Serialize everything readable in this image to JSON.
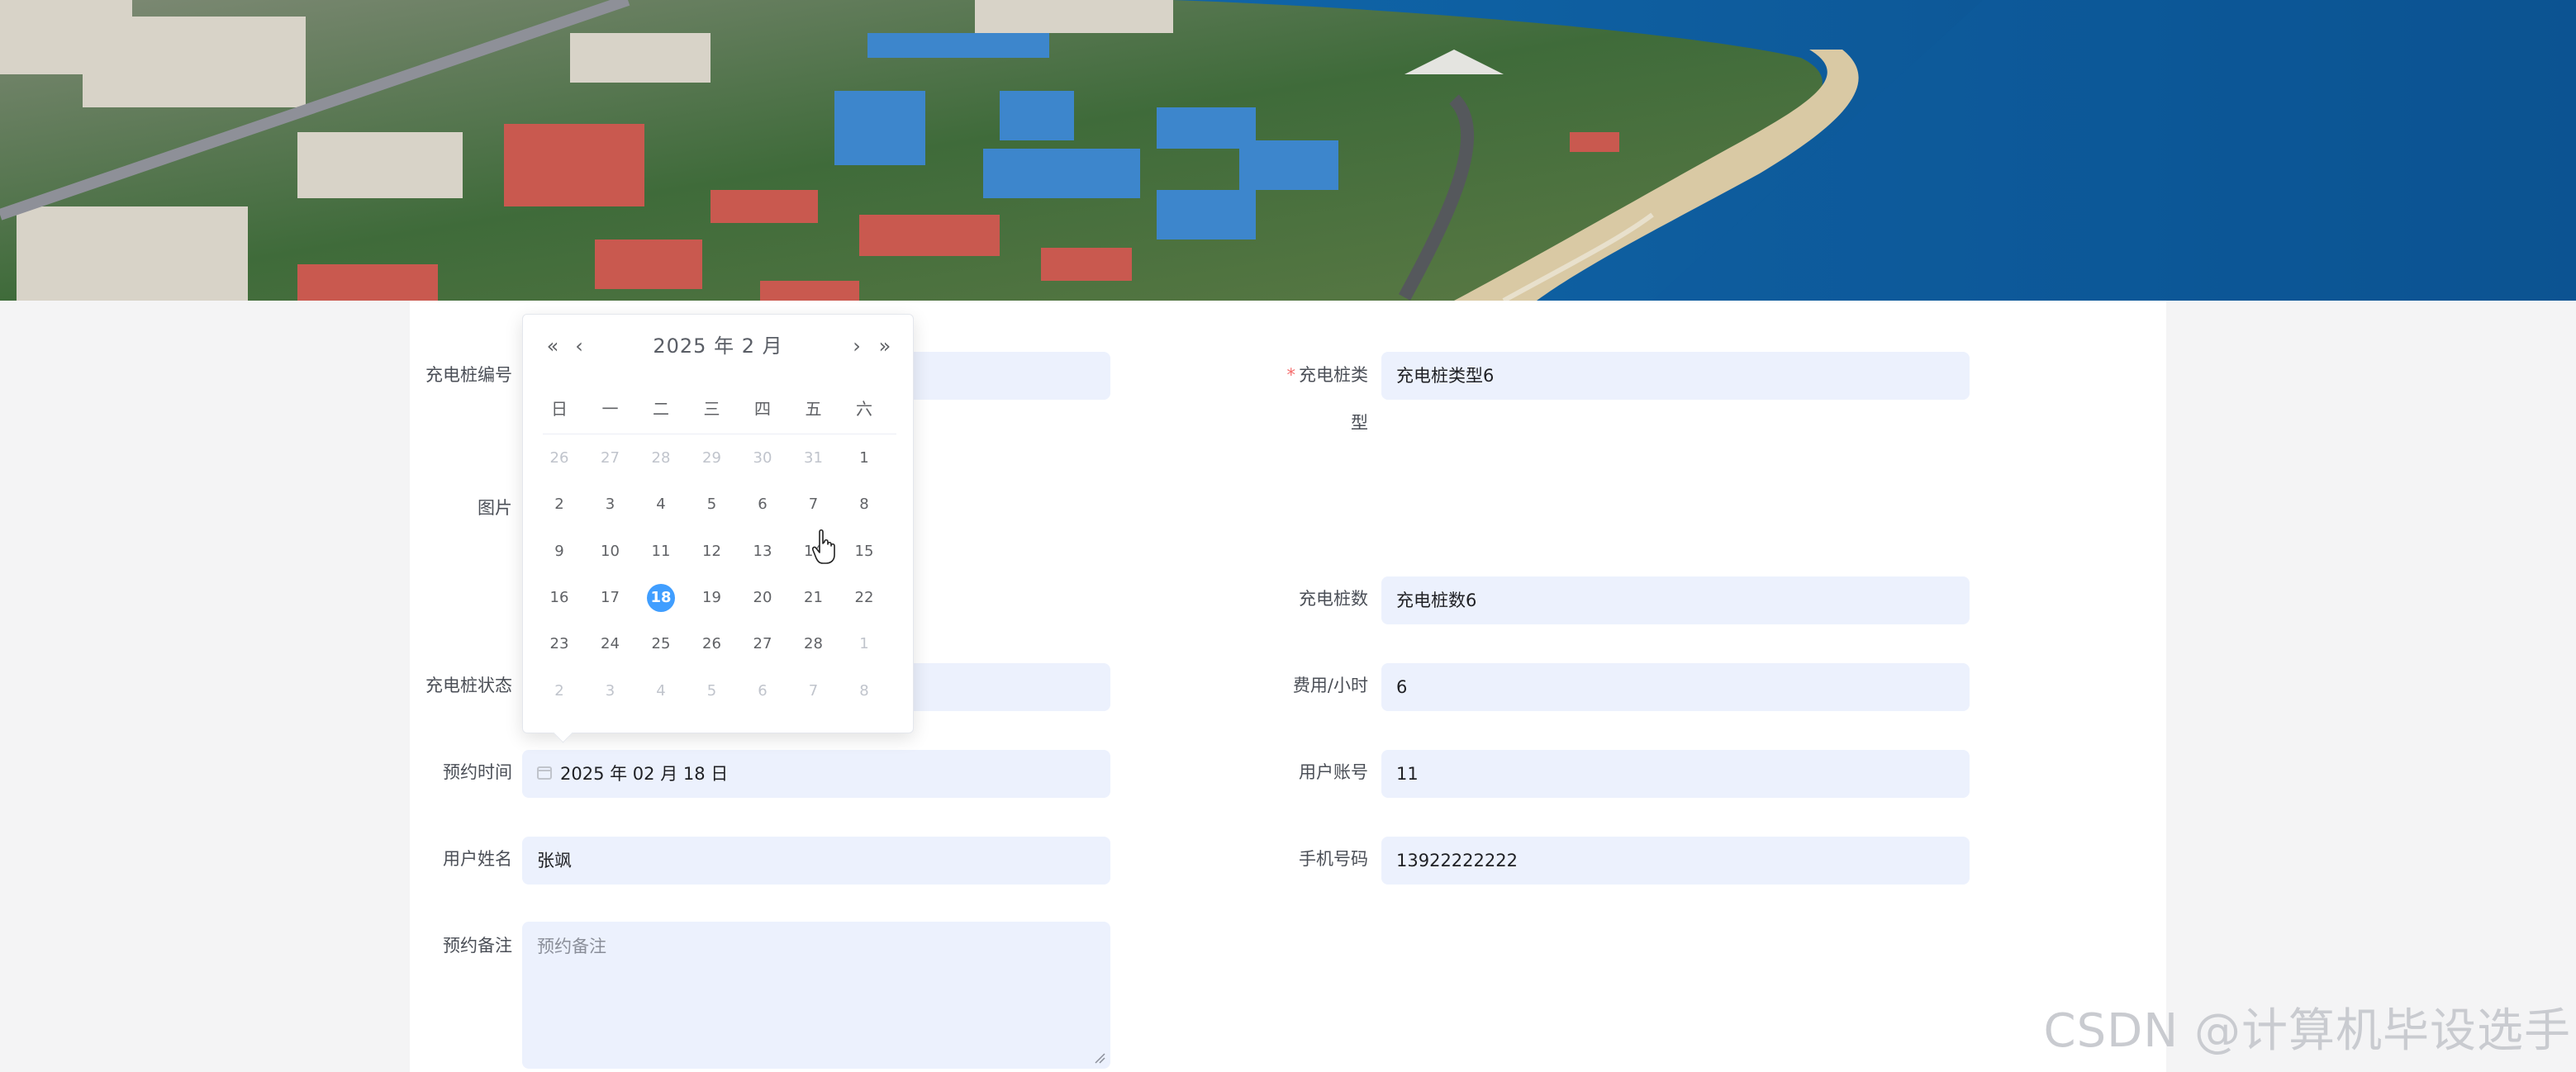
{
  "form": {
    "pile_no": {
      "label": "充电桩编号",
      "value": ""
    },
    "pile_type": {
      "required_mark": "*",
      "label_line1": "充电桩类",
      "label_line2": "型",
      "value": "充电桩类型6"
    },
    "image": {
      "label": "图片"
    },
    "pile_count": {
      "label": "充电桩数",
      "value": "充电桩数6"
    },
    "pile_status": {
      "label": "充电桩状态",
      "value": ""
    },
    "fee_per_hour": {
      "label": "费用/小时",
      "value": "6"
    },
    "booking_time": {
      "label": "预约时间",
      "value": "2025 年 02 月 18 日"
    },
    "user_account": {
      "label": "用户账号",
      "value": "11"
    },
    "user_name": {
      "label": "用户姓名",
      "value": "张飒"
    },
    "phone": {
      "label": "手机号码",
      "value": "13922222222"
    },
    "remark": {
      "label": "预约备注",
      "placeholder": "预约备注"
    }
  },
  "datepicker": {
    "title": "2025 年  2 月",
    "prev_year": "«",
    "prev_month": "‹",
    "next_month": "›",
    "next_year": "»",
    "weekdays": [
      "日",
      "一",
      "二",
      "三",
      "四",
      "五",
      "六"
    ],
    "weeks": [
      [
        {
          "d": "26",
          "other": true
        },
        {
          "d": "27",
          "other": true
        },
        {
          "d": "28",
          "other": true
        },
        {
          "d": "29",
          "other": true
        },
        {
          "d": "30",
          "other": true
        },
        {
          "d": "31",
          "other": true
        },
        {
          "d": "1"
        }
      ],
      [
        {
          "d": "2"
        },
        {
          "d": "3"
        },
        {
          "d": "4"
        },
        {
          "d": "5"
        },
        {
          "d": "6"
        },
        {
          "d": "7"
        },
        {
          "d": "8"
        }
      ],
      [
        {
          "d": "9"
        },
        {
          "d": "10"
        },
        {
          "d": "11"
        },
        {
          "d": "12"
        },
        {
          "d": "13"
        },
        {
          "d": "14"
        },
        {
          "d": "15"
        }
      ],
      [
        {
          "d": "16"
        },
        {
          "d": "17"
        },
        {
          "d": "18",
          "selected": true
        },
        {
          "d": "19"
        },
        {
          "d": "20"
        },
        {
          "d": "21"
        },
        {
          "d": "22"
        }
      ],
      [
        {
          "d": "23"
        },
        {
          "d": "24"
        },
        {
          "d": "25"
        },
        {
          "d": "26"
        },
        {
          "d": "27"
        },
        {
          "d": "28"
        },
        {
          "d": "1",
          "other": true
        }
      ],
      [
        {
          "d": "2",
          "other": true
        },
        {
          "d": "3",
          "other": true
        },
        {
          "d": "4",
          "other": true
        },
        {
          "d": "5",
          "other": true
        },
        {
          "d": "6",
          "other": true
        },
        {
          "d": "7",
          "other": true
        },
        {
          "d": "8",
          "other": true
        }
      ]
    ]
  },
  "watermark": "CSDN @计算机毕设选手",
  "colors": {
    "accent": "#409eff",
    "input_bg": "#ecf1fd",
    "required": "#f56c6c"
  }
}
